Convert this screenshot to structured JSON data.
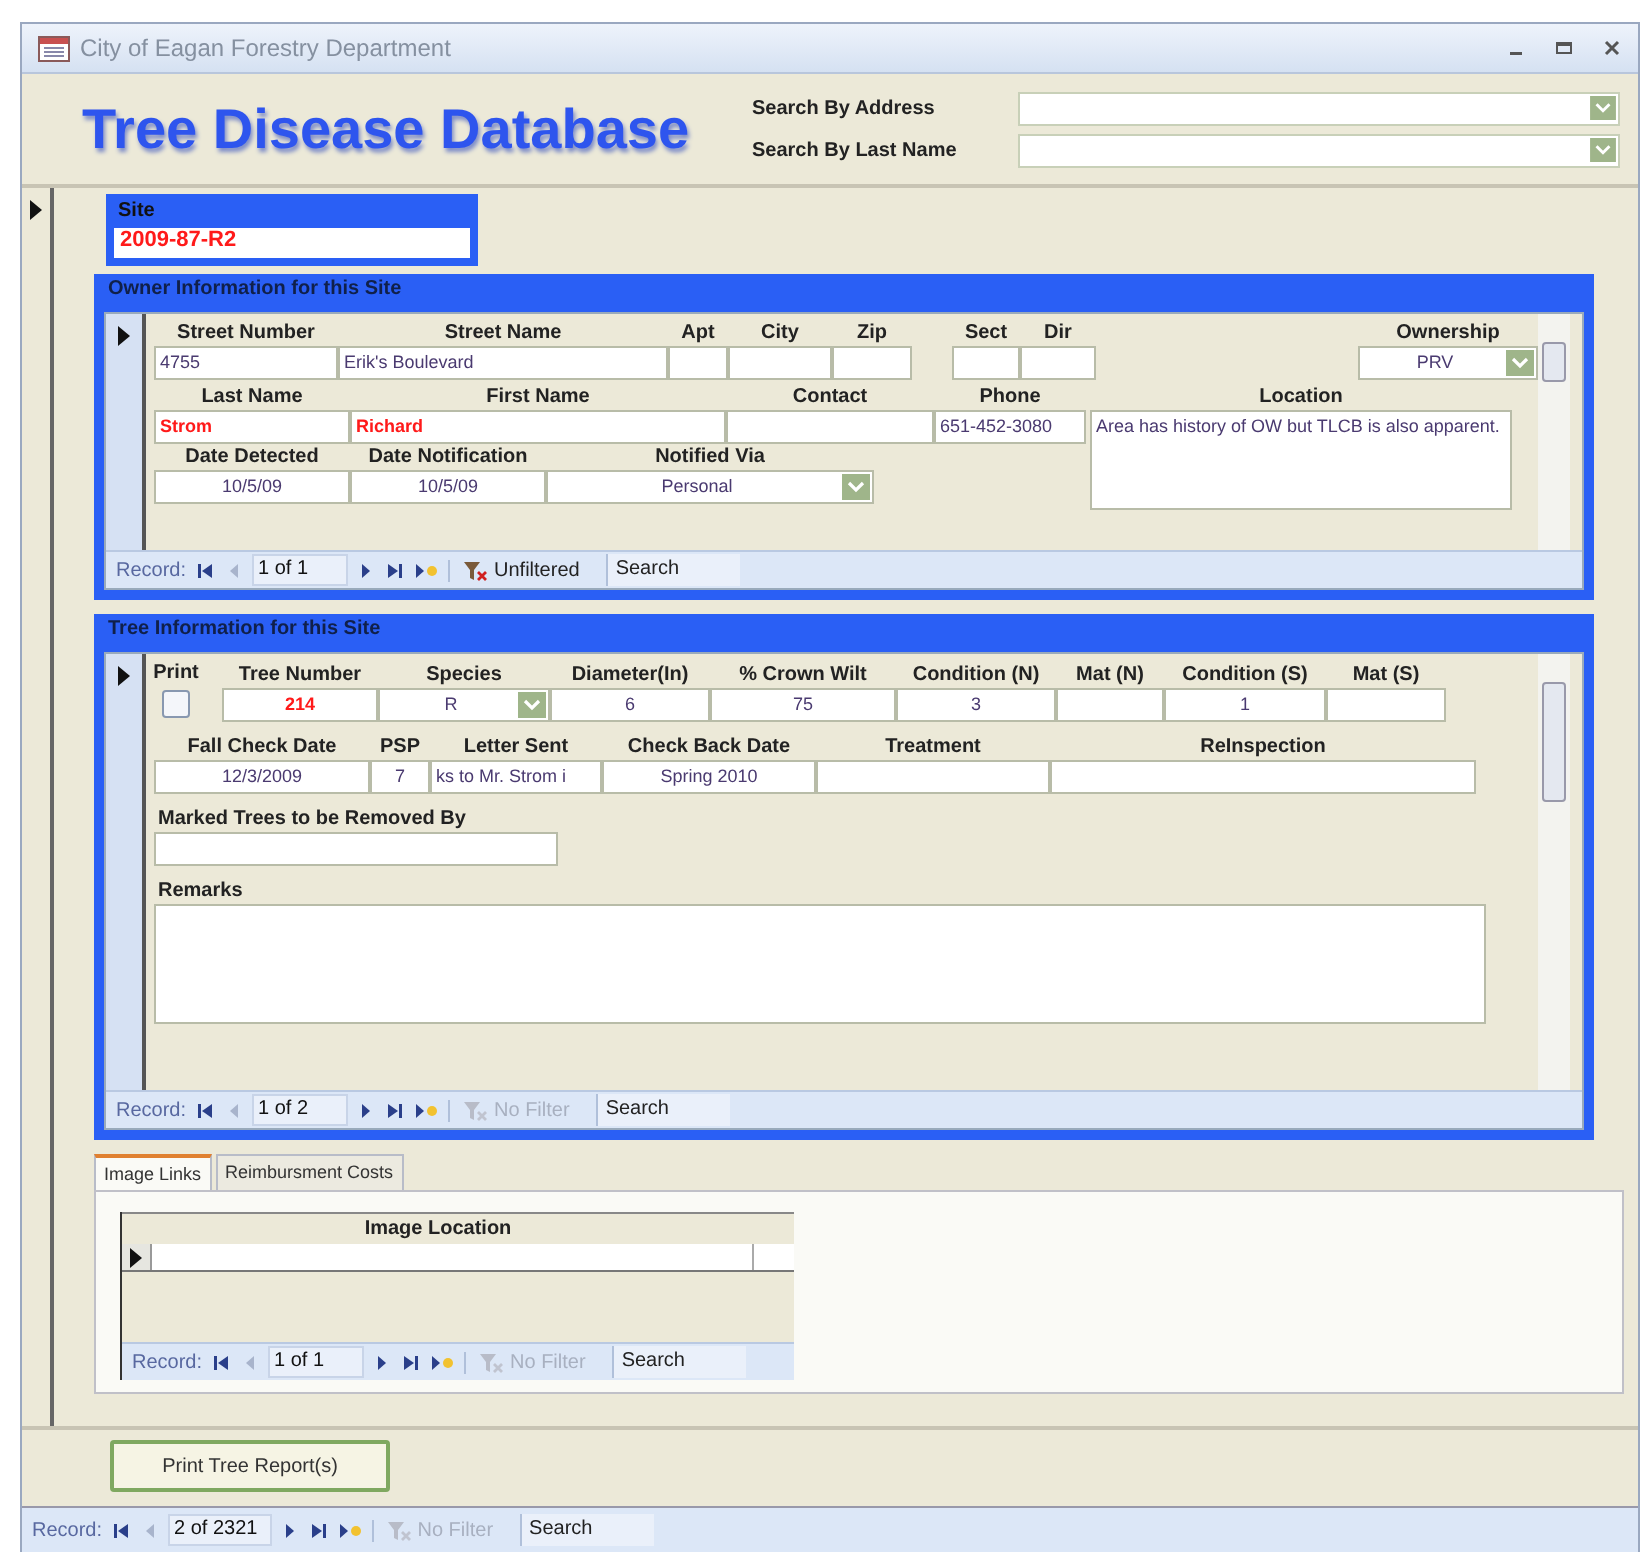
{
  "window": {
    "title": "City of Eagan Forestry Department"
  },
  "header": {
    "title": "Tree Disease Database",
    "searches": [
      {
        "label": "Search By Address"
      },
      {
        "label": "Search By Last Name"
      }
    ]
  },
  "site": {
    "label": "Site",
    "value": "2009-87-R2",
    "highlighted": true
  },
  "owner": {
    "title": "Owner Information for this Site",
    "address_fields": [
      {
        "label": "Street Number",
        "value": "4755",
        "kind": "text",
        "highlighted": false
      },
      {
        "label": "Street Name",
        "value": "Erik's Boulevard",
        "kind": "text",
        "highlighted": false
      },
      {
        "label": "Apt",
        "kind": "text"
      },
      {
        "label": "City",
        "kind": "text"
      },
      {
        "label": "Zip",
        "kind": "text"
      },
      {
        "label": "Sect",
        "kind": "text"
      },
      {
        "label": "Dir",
        "kind": "text"
      },
      {
        "label": "Ownership",
        "value": "PRV",
        "kind": "combo",
        "highlighted": false
      }
    ],
    "name_fields": [
      {
        "label": "Last Name",
        "value": "Strom",
        "kind": "text",
        "highlighted": true
      },
      {
        "label": "First Name",
        "value": "Richard",
        "kind": "text",
        "highlighted": true
      },
      {
        "label": "Contact",
        "kind": "text"
      },
      {
        "label": "Phone",
        "value": "651-452-3080",
        "kind": "text",
        "highlighted": false
      }
    ],
    "notice_fields": [
      {
        "label": "Date Detected",
        "value": "10/5/09",
        "kind": "date",
        "highlighted": false
      },
      {
        "label": "Date Notification",
        "value": "10/5/09",
        "kind": "date",
        "highlighted": false
      },
      {
        "label": "Notified Via",
        "value": "Personal",
        "kind": "combo",
        "highlighted": false
      }
    ],
    "location": {
      "label": "Location",
      "value": "Area has history of OW but TLCB is also apparent.",
      "kind": "memo",
      "highlighted": false
    },
    "navigator": {
      "label": "Record:",
      "position": "1 of 1",
      "filter": "Unfiltered",
      "filter_enabled": true,
      "search": "Search"
    }
  },
  "tree": {
    "title": "Tree Information for this Site",
    "measure_fields": [
      {
        "label": "Print",
        "kind": "checkbox",
        "checked": false
      },
      {
        "label": "Tree Number",
        "value": "214",
        "kind": "number",
        "highlighted": true
      },
      {
        "label": "Species",
        "value": "R",
        "kind": "combo",
        "highlighted": false
      },
      {
        "label": "Diameter(In)",
        "value": "6",
        "kind": "number",
        "highlighted": false
      },
      {
        "label": "% Crown Wilt",
        "value": "75",
        "kind": "number",
        "highlighted": false
      },
      {
        "label": "Condition (N)",
        "value": "3",
        "kind": "number",
        "highlighted": false
      },
      {
        "label": "Mat (N)",
        "kind": "number"
      },
      {
        "label": "Condition (S)",
        "value": "1",
        "kind": "number",
        "highlighted": false
      },
      {
        "label": "Mat (S)",
        "kind": "number"
      }
    ],
    "check_fields": [
      {
        "label": "Fall Check Date",
        "value": "12/3/2009",
        "kind": "date",
        "highlighted": false
      },
      {
        "label": "PSP",
        "value": "7",
        "kind": "number",
        "highlighted": false
      },
      {
        "label": "Letter Sent",
        "value": "ks to Mr. Strom i",
        "kind": "text",
        "highlighted": false
      },
      {
        "label": "Check Back Date",
        "value": "Spring 2010",
        "kind": "date",
        "highlighted": false
      },
      {
        "label": "Treatment",
        "kind": "text"
      },
      {
        "label": "ReInspection",
        "kind": "text"
      }
    ],
    "removal": {
      "label": "Marked Trees to be Removed By",
      "kind": "text"
    },
    "remarks": {
      "label": "Remarks",
      "kind": "memo"
    },
    "navigator": {
      "label": "Record:",
      "position": "1 of 2",
      "filter": "No Filter",
      "filter_enabled": false,
      "search": "Search"
    }
  },
  "tabs": [
    {
      "label": "Image Links",
      "selected": true
    },
    {
      "label": "Reimbursment Costs",
      "selected": false
    }
  ],
  "image_links": {
    "column": "Image Location",
    "navigator": {
      "label": "Record:",
      "position": "1 of 1",
      "filter": "No Filter",
      "filter_enabled": false,
      "search": "Search"
    }
  },
  "buttons": [
    {
      "label": "Print Tree Report(s)"
    }
  ],
  "status_navigator": {
    "label": "Record:",
    "position": "2 of 2321",
    "filter": "No Filter",
    "filter_enabled": false,
    "search": "Search"
  }
}
